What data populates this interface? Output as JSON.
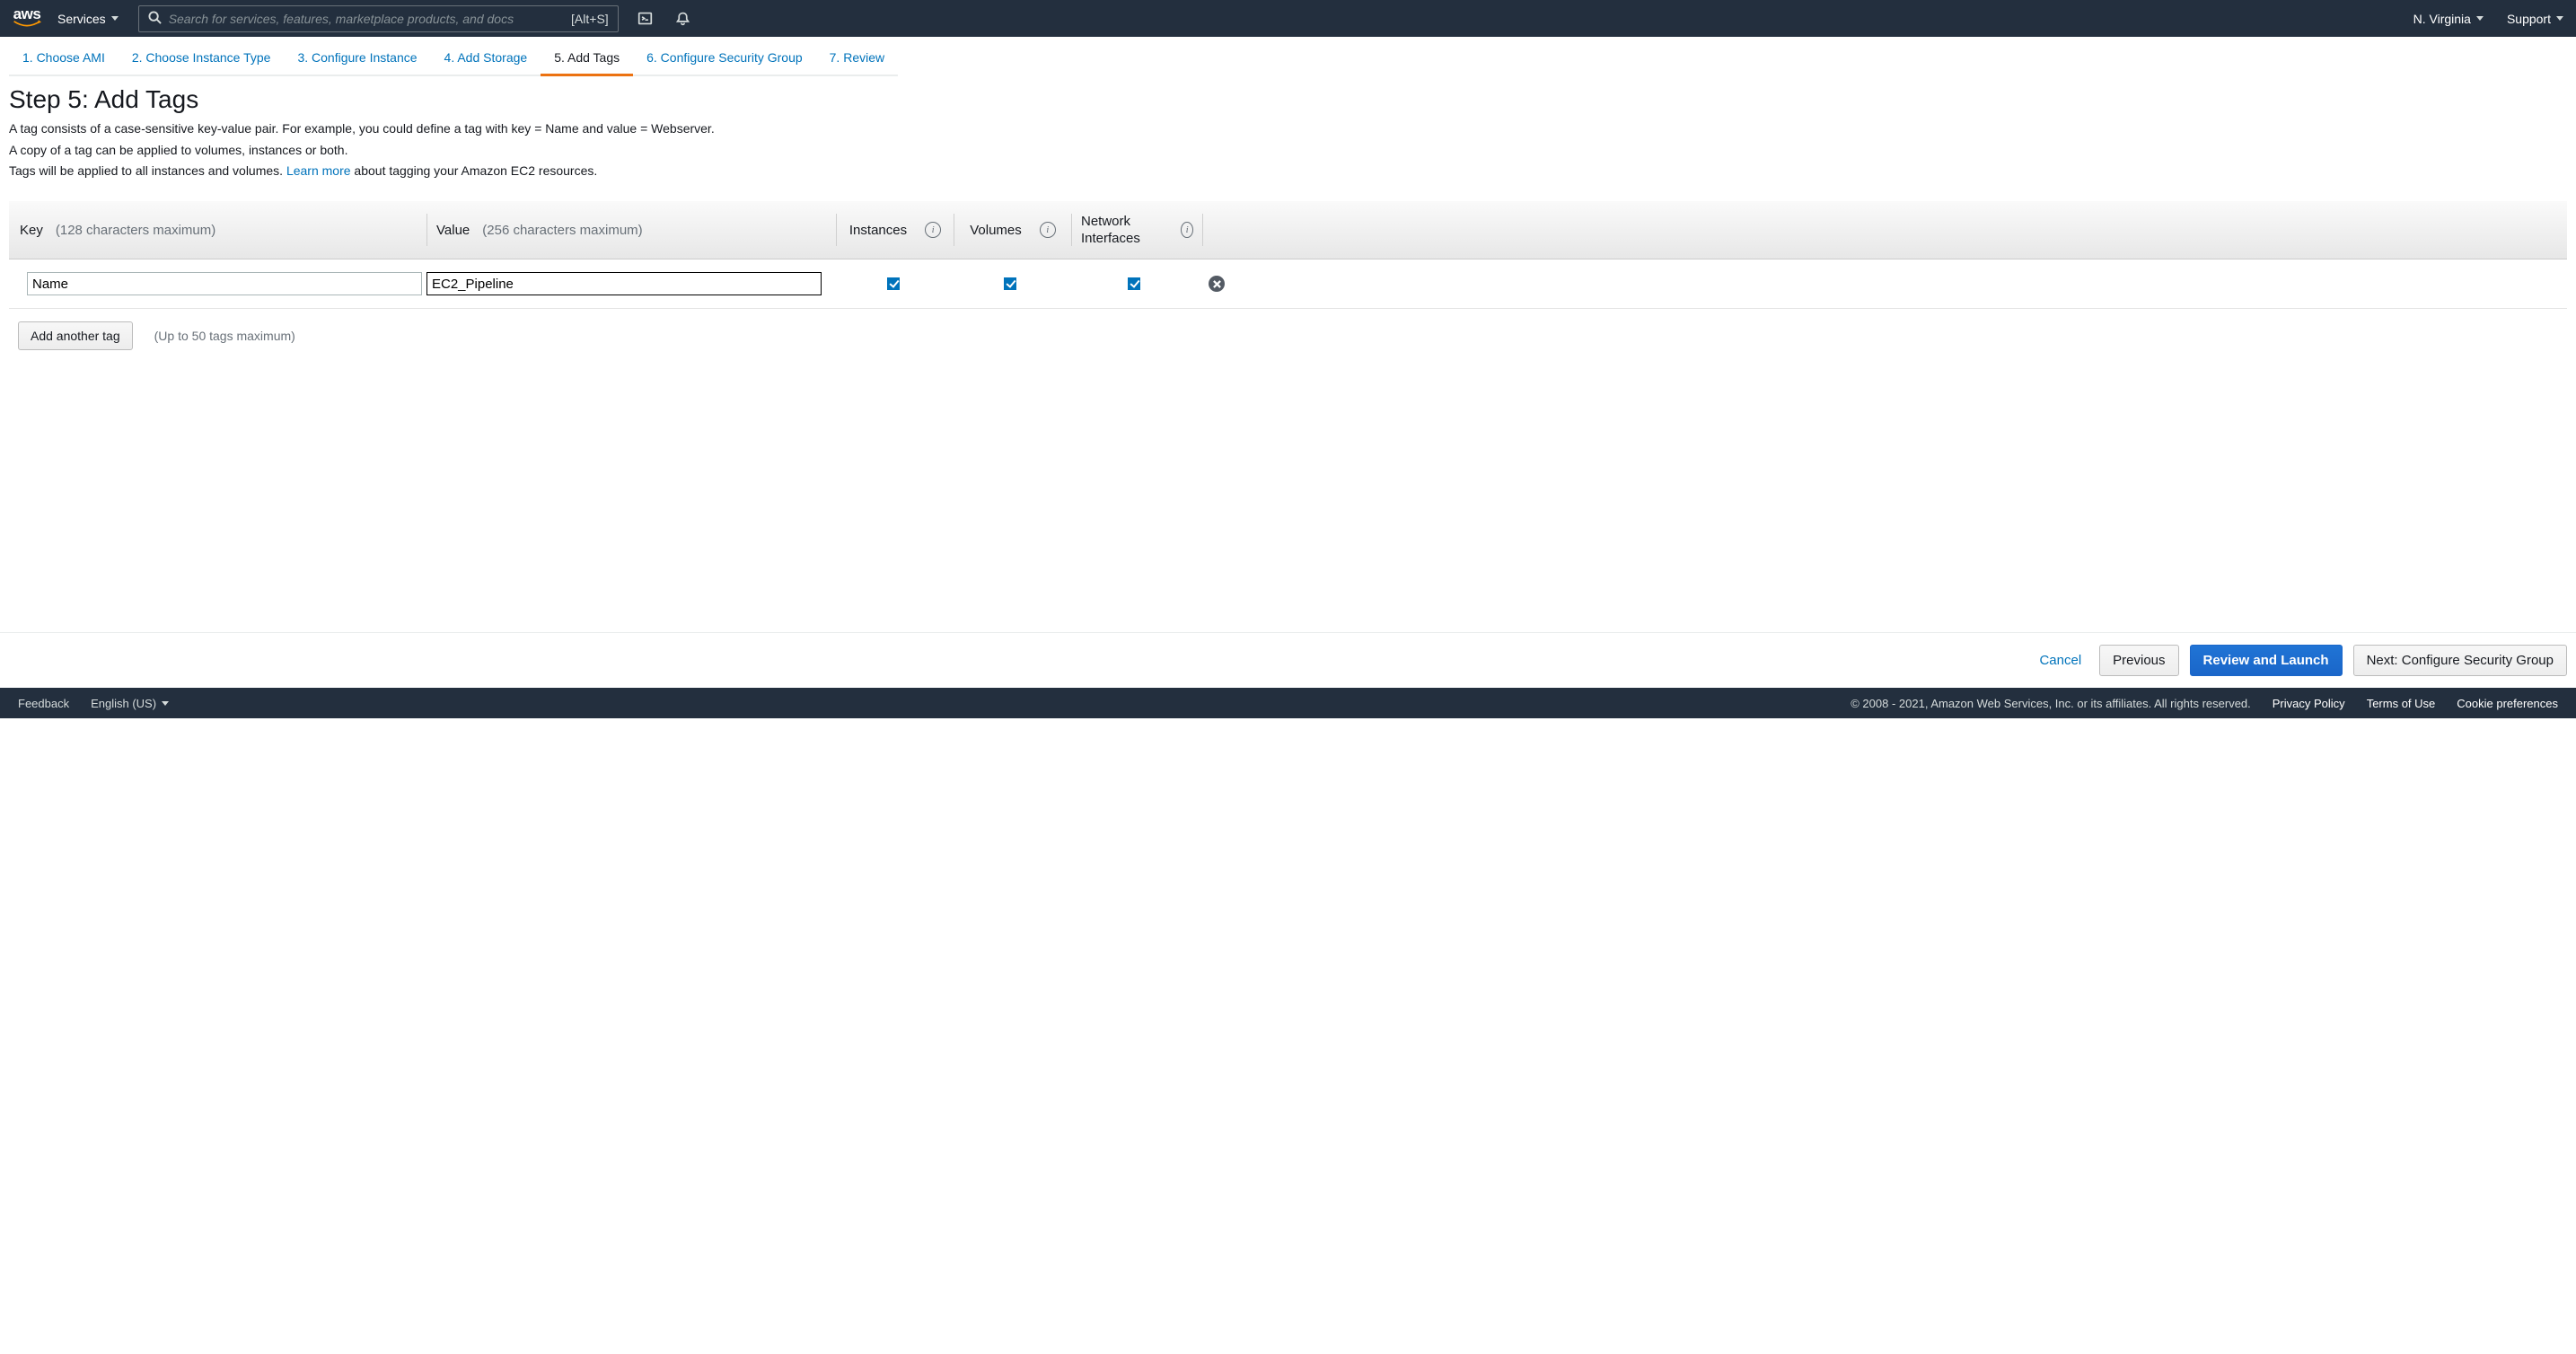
{
  "topnav": {
    "services_label": "Services",
    "search_placeholder": "Search for services, features, marketplace products, and docs",
    "search_shortcut": "[Alt+S]",
    "region": "N. Virginia",
    "support_label": "Support"
  },
  "wizard": {
    "steps": [
      {
        "label": "1. Choose AMI"
      },
      {
        "label": "2. Choose Instance Type"
      },
      {
        "label": "3. Configure Instance"
      },
      {
        "label": "4. Add Storage"
      },
      {
        "label": "5. Add Tags"
      },
      {
        "label": "6. Configure Security Group"
      },
      {
        "label": "7. Review"
      }
    ],
    "active_index": 4
  },
  "page": {
    "title": "Step 5: Add Tags",
    "desc_line1": "A tag consists of a case-sensitive key-value pair. For example, you could define a tag with key = Name and value = Webserver.",
    "desc_line2": "A copy of a tag can be applied to volumes, instances or both.",
    "desc_line3_a": "Tags will be applied to all instances and volumes. ",
    "desc_line3_link": "Learn more",
    "desc_line3_b": " about tagging your Amazon EC2 resources."
  },
  "table": {
    "columns": {
      "key_label": "Key",
      "key_hint": "(128 characters maximum)",
      "value_label": "Value",
      "value_hint": "(256 characters maximum)",
      "instances_label": "Instances",
      "volumes_label": "Volumes",
      "network_label": "Network Interfaces"
    },
    "rows": [
      {
        "key": "Name",
        "value": "EC2_Pipeline",
        "instances": true,
        "volumes": true,
        "network": true
      }
    ],
    "add_button": "Add another tag",
    "add_hint": "(Up to 50 tags maximum)"
  },
  "footer_buttons": {
    "cancel": "Cancel",
    "previous": "Previous",
    "review": "Review and Launch",
    "next": "Next: Configure Security Group"
  },
  "bottombar": {
    "feedback": "Feedback",
    "language": "English (US)",
    "copyright": "© 2008 - 2021, Amazon Web Services, Inc. or its affiliates. All rights reserved.",
    "privacy": "Privacy Policy",
    "terms": "Terms of Use",
    "cookies": "Cookie preferences"
  }
}
